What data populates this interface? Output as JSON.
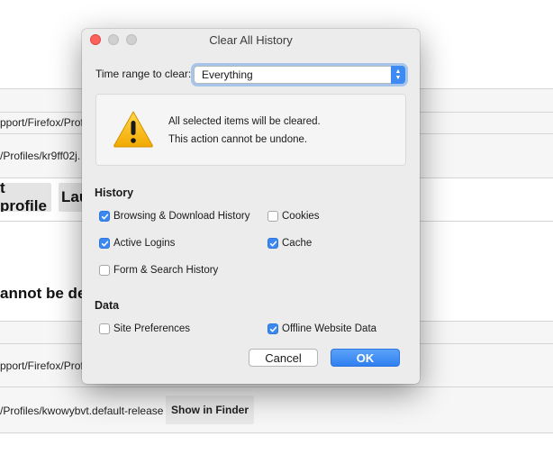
{
  "background": {
    "path_1": "pport/Firefox/Prof",
    "path_2": "/Profiles/kr9ff02j.",
    "button_1": "t profile",
    "button_2": "Lau",
    "heading": "annot be de",
    "path_3": "pport/Firefox/Prof",
    "path_4": "/Profiles/kwowybvt.default-release",
    "show_in_finder": "Show in Finder"
  },
  "dialog": {
    "title": "Clear All History",
    "time_range_label": "Time range to clear:",
    "time_range_value": "Everything",
    "warning_line_1": "All selected items will be cleared.",
    "warning_line_2": "This action cannot be undone.",
    "history_heading": "History",
    "data_heading": "Data",
    "options": {
      "browsing_download": {
        "label": "Browsing & Download History",
        "checked": true
      },
      "cookies": {
        "label": "Cookies",
        "checked": false
      },
      "active_logins": {
        "label": "Active Logins",
        "checked": true
      },
      "cache": {
        "label": "Cache",
        "checked": true
      },
      "form_search": {
        "label": "Form & Search History",
        "checked": false
      },
      "site_preferences": {
        "label": "Site Preferences",
        "checked": false
      },
      "offline_data": {
        "label": "Offline Website Data",
        "checked": true
      }
    },
    "cancel_label": "Cancel",
    "ok_label": "OK"
  },
  "colors": {
    "accent": "#3b88f2",
    "close_button": "#fc615d",
    "warning_icon": "#f5b400"
  }
}
